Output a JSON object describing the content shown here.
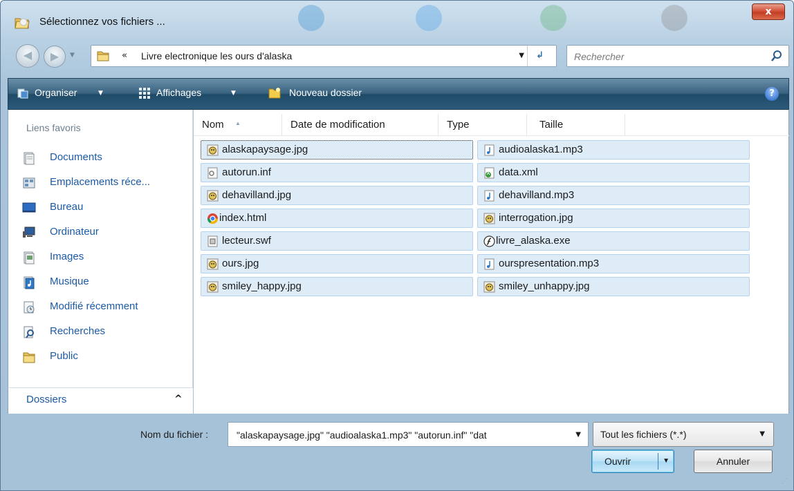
{
  "window": {
    "title": "Sélectionnez vos fichiers ...",
    "close_glyph": "x"
  },
  "address": {
    "separator": "«",
    "path": "Livre electronique les ours d'alaska"
  },
  "search": {
    "placeholder": "Rechercher"
  },
  "toolbar": {
    "organize_label": "Organiser",
    "views_label": "Affichages",
    "new_folder_label": "Nouveau dossier",
    "help_glyph": "?"
  },
  "sidebar": {
    "header": "Liens favoris",
    "items": [
      {
        "label": "Documents",
        "icon": "documents-icon"
      },
      {
        "label": "Emplacements réce...",
        "icon": "recent-places-icon"
      },
      {
        "label": "Bureau",
        "icon": "desktop-icon"
      },
      {
        "label": "Ordinateur",
        "icon": "computer-icon"
      },
      {
        "label": "Images",
        "icon": "pictures-icon"
      },
      {
        "label": "Musique",
        "icon": "music-icon"
      },
      {
        "label": "Modifié récemment",
        "icon": "recently-changed-icon"
      },
      {
        "label": "Recherches",
        "icon": "searches-icon"
      },
      {
        "label": "Public",
        "icon": "public-folder-icon"
      }
    ],
    "folders_label": "Dossiers"
  },
  "columns": [
    "Nom",
    "Date de modification",
    "Type",
    "Taille"
  ],
  "files": {
    "left": [
      {
        "name": "alaskapaysage.jpg",
        "icon": "image-file-icon"
      },
      {
        "name": "autorun.inf",
        "icon": "settings-file-icon"
      },
      {
        "name": "dehavilland.jpg",
        "icon": "image-file-icon"
      },
      {
        "name": "index.html",
        "icon": "chrome-html-icon"
      },
      {
        "name": "lecteur.swf",
        "icon": "swf-file-icon"
      },
      {
        "name": "ours.jpg",
        "icon": "image-file-icon"
      },
      {
        "name": "smiley_happy.jpg",
        "icon": "image-file-icon"
      }
    ],
    "right": [
      {
        "name": "audioalaska1.mp3",
        "icon": "audio-file-icon"
      },
      {
        "name": "data.xml",
        "icon": "xml-file-icon"
      },
      {
        "name": "dehavilland.mp3",
        "icon": "audio-file-icon"
      },
      {
        "name": "interrogation.jpg",
        "icon": "image-file-icon"
      },
      {
        "name": "livre_alaska.exe",
        "icon": "flash-exe-icon"
      },
      {
        "name": "ourspresentation.mp3",
        "icon": "audio-file-icon"
      },
      {
        "name": "smiley_unhappy.jpg",
        "icon": "image-file-icon"
      }
    ]
  },
  "footer": {
    "filename_label": "Nom du fichier :",
    "filename_value": "\"alaskapaysage.jpg\" \"audioalaska1.mp3\" \"autorun.inf\" \"dat",
    "filetype_value": "Tout les fichiers (*.*)",
    "open_label": "Ouvrir",
    "cancel_label": "Annuler"
  },
  "colors": {
    "accent_link": "#1c5aa6",
    "selection_bg": "#deecf8",
    "toolbar_dark": "#2b5a78"
  }
}
